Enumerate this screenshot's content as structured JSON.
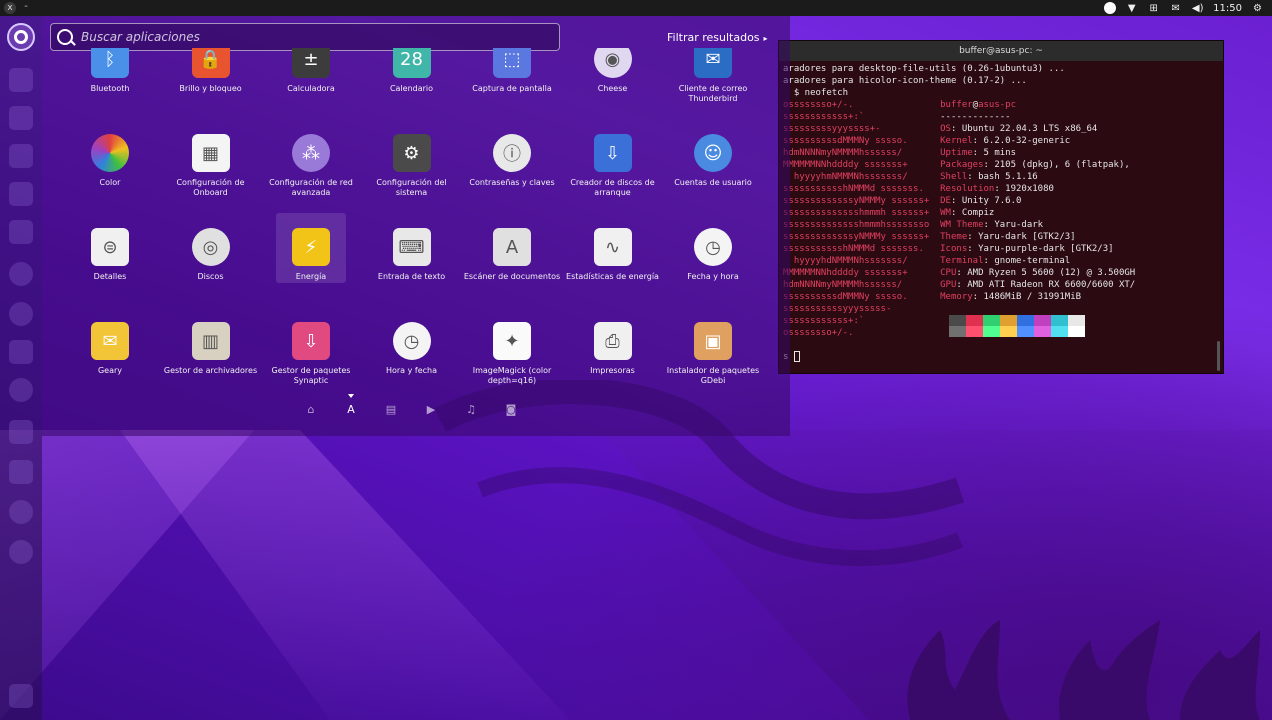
{
  "top_panel": {
    "close_glyph": "x",
    "min_glyph": "-",
    "clock": "11:50",
    "indicators": [
      "circle-icon",
      "wifi-icon",
      "network-icon",
      "mail-icon",
      "volume-icon"
    ]
  },
  "search": {
    "placeholder": "Buscar aplicaciones",
    "value": ""
  },
  "filter": {
    "label": "Filtrar resultados",
    "arrow": "▸"
  },
  "apps": [
    {
      "name": "Bluetooth",
      "icon": "bluetooth-icon",
      "color": "#4a90e8"
    },
    {
      "name": "Brillo y bloqueo",
      "icon": "lock-icon",
      "color": "#e8542f"
    },
    {
      "name": "Calculadora",
      "icon": "calculator-icon",
      "color": "#3c3c3c"
    },
    {
      "name": "Calendario",
      "icon": "calendar-icon",
      "color": "#3fb6a8"
    },
    {
      "name": "Captura de pantalla",
      "icon": "screenshot-icon",
      "color": "#5a78e0"
    },
    {
      "name": "Cheese",
      "icon": "camera-icon",
      "color": "#e0d8f0"
    },
    {
      "name": "Cliente de correo Thunderbird",
      "icon": "thunderbird-icon",
      "color": "#2b6cc4"
    },
    {
      "name": "Color",
      "icon": "color-wheel-icon",
      "color": "#f0a020"
    },
    {
      "name": "Configuración de Onboard",
      "icon": "keyboard-icon",
      "color": "#f4f4f4"
    },
    {
      "name": "Configuración de red avanzada",
      "icon": "network-settings-icon",
      "color": "#9a7ad8"
    },
    {
      "name": "Configuración del sistema",
      "icon": "gear-icon",
      "color": "#4a4a4a"
    },
    {
      "name": "Contraseñas y claves",
      "icon": "key-icon",
      "color": "#e8e8e8"
    },
    {
      "name": "Creador de discos de arranque",
      "icon": "usb-icon",
      "color": "#3a70d8"
    },
    {
      "name": "Cuentas de usuario",
      "icon": "users-icon",
      "color": "#4a8ae0"
    },
    {
      "name": "Detalles",
      "icon": "details-icon",
      "color": "#f0f0f0"
    },
    {
      "name": "Discos",
      "icon": "disk-icon",
      "color": "#e0e0e0"
    },
    {
      "name": "Energía",
      "icon": "power-icon",
      "color": "#f2c418"
    },
    {
      "name": "Entrada de texto",
      "icon": "text-input-icon",
      "color": "#e8e8e8"
    },
    {
      "name": "Escáner de documentos",
      "icon": "scanner-icon",
      "color": "#e0e0e0"
    },
    {
      "name": "Estadísticas de energía",
      "icon": "power-stats-icon",
      "color": "#f0f0f0"
    },
    {
      "name": "Fecha y hora",
      "icon": "clock-icon",
      "color": "#f4f4f4"
    },
    {
      "name": "Geary",
      "icon": "mail-icon",
      "color": "#f2c438"
    },
    {
      "name": "Gestor de archivadores",
      "icon": "archive-icon",
      "color": "#d8d0c0"
    },
    {
      "name": "Gestor de paquetes Synaptic",
      "icon": "package-icon",
      "color": "#e04a80"
    },
    {
      "name": "Hora y fecha",
      "icon": "clock-icon",
      "color": "#f4f4f4"
    },
    {
      "name": "ImageMagick (color depth=q16)",
      "icon": "imagemagick-icon",
      "color": "#fafafa"
    },
    {
      "name": "Impresoras",
      "icon": "printer-icon",
      "color": "#f0f0f0"
    },
    {
      "name": "Instalador de paquetes GDebi",
      "icon": "gdebi-icon",
      "color": "#e0a060"
    }
  ],
  "scopes": [
    "home-icon",
    "apps-icon",
    "files-icon",
    "video-icon",
    "music-icon",
    "photo-icon"
  ],
  "terminal": {
    "title": "buffer@asus-pc: ~",
    "lines_pre": [
      "aradores para desktop-file-utils (0.26-1ubuntu3) ...",
      "aradores para hicolor-icon-theme (0.17-2) ...",
      "  $ neofetch"
    ],
    "user": "buffer",
    "host": "asus-pc",
    "separator": "-------------",
    "info": [
      {
        "k": "OS",
        "v": "Ubuntu 22.04.3 LTS x86_64"
      },
      {
        "k": "Kernel",
        "v": "6.2.0-32-generic"
      },
      {
        "k": "Uptime",
        "v": "5 mins"
      },
      {
        "k": "Packages",
        "v": "2105 (dpkg), 6 (flatpak),"
      },
      {
        "k": "Shell",
        "v": "bash 5.1.16"
      },
      {
        "k": "Resolution",
        "v": "1920x1080"
      },
      {
        "k": "DE",
        "v": "Unity 7.6.0"
      },
      {
        "k": "WM",
        "v": "Compiz"
      },
      {
        "k": "WM Theme",
        "v": "Yaru-dark"
      },
      {
        "k": "Theme",
        "v": "Yaru-dark [GTK2/3]"
      },
      {
        "k": "Icons",
        "v": "Yaru-purple-dark [GTK2/3]"
      },
      {
        "k": "Terminal",
        "v": "gnome-terminal"
      },
      {
        "k": "CPU",
        "v": "AMD Ryzen 5 5600 (12) @ 3.500GH"
      },
      {
        "k": "GPU",
        "v": "AMD ATI Radeon RX 6600/6600 XT/"
      },
      {
        "k": "Memory",
        "v": "1486MiB / 31991MiB"
      }
    ],
    "logo": [
      "ossssssso+/-.",
      "ssssssssssss+:`",
      "sssssssssyyyssss+-",
      "ssssssssssdMMMNy sssso.",
      "hdmNNNNmyNMMMMhssssss/",
      "MMMMMMNNhddddy sssssss+",
      "  hyyyyhmNMMMNhsssssss/",
      "ssssssssssshNMMMd sssssss.",
      "sssssssssssssyNMMMy ssssss+",
      "sssssssssssssshmmmh ssssss+",
      "sssssssssssssshmmmhssssssso",
      "sssssssssssssyNMMMy ssssss+",
      "ssssssssssshNMMMd sssssss.",
      "  hyyyyhdNMMMNhsssssss/",
      "MMMMMMNNhddddy sssssss+",
      "hdmNNNNmyNMMMMhssssss/",
      "ssssssssssdMMMNy sssso.",
      "sssssssssssyyysssss-",
      "ssssssssssss+:`",
      "ossssssso+/-."
    ],
    "prompt_tail": "s",
    "palette_top": [
      "#4a4a4a",
      "#e03050",
      "#30d070",
      "#e0a030",
      "#3070e0",
      "#c040c0",
      "#30c0d0",
      "#e8e8e8"
    ],
    "palette_bottom": [
      "#707070",
      "#ff5070",
      "#50ff90",
      "#ffd050",
      "#5090ff",
      "#e060e0",
      "#50e0f0",
      "#ffffff"
    ]
  }
}
